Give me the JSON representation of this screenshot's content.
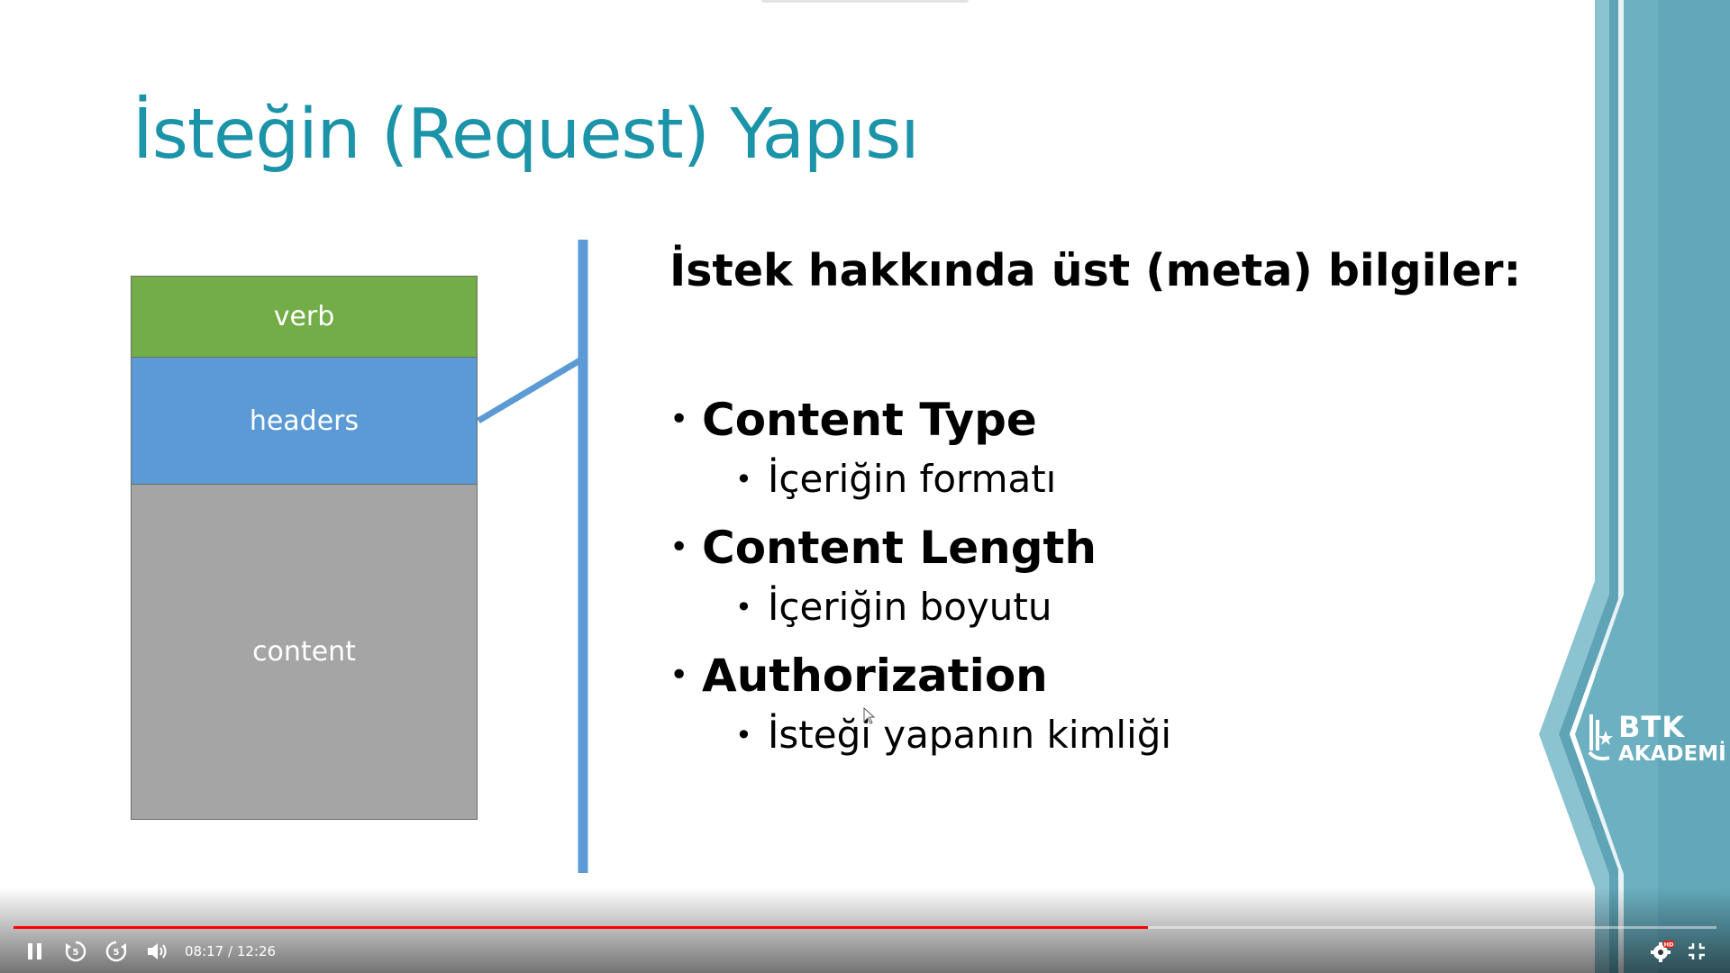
{
  "slide": {
    "title": "İsteğin (Request) Yapısı",
    "diagram": {
      "segments": {
        "verb": "verb",
        "headers": "headers",
        "content": "content"
      },
      "colors": {
        "verb": "#72ad47",
        "headers": "#5b9ad5",
        "content": "#a5a5a5"
      }
    },
    "heading": "İstek hakkında üst (meta) bilgiler:",
    "items": [
      {
        "label": "Content Type",
        "sub": "İçeriğin formatı"
      },
      {
        "label": "Content Length",
        "sub": "İçeriğin boyutu"
      },
      {
        "label": "Authorization",
        "sub": "İsteği yapanın kimliği"
      }
    ],
    "logo": {
      "line1": "BTK",
      "line2": "AKADEMİ"
    },
    "accent_color": "#1b93a8"
  },
  "player": {
    "time_display": "08:17 / 12:26",
    "progress": 0.666,
    "colors": {
      "progress": "#ff0000"
    },
    "icons": [
      "pause-icon",
      "rewind-5-icon",
      "forward-5-icon",
      "volume-icon",
      "settings-icon",
      "hd-badge-icon",
      "exit-fullscreen-icon"
    ],
    "hd_badge": "HD"
  }
}
